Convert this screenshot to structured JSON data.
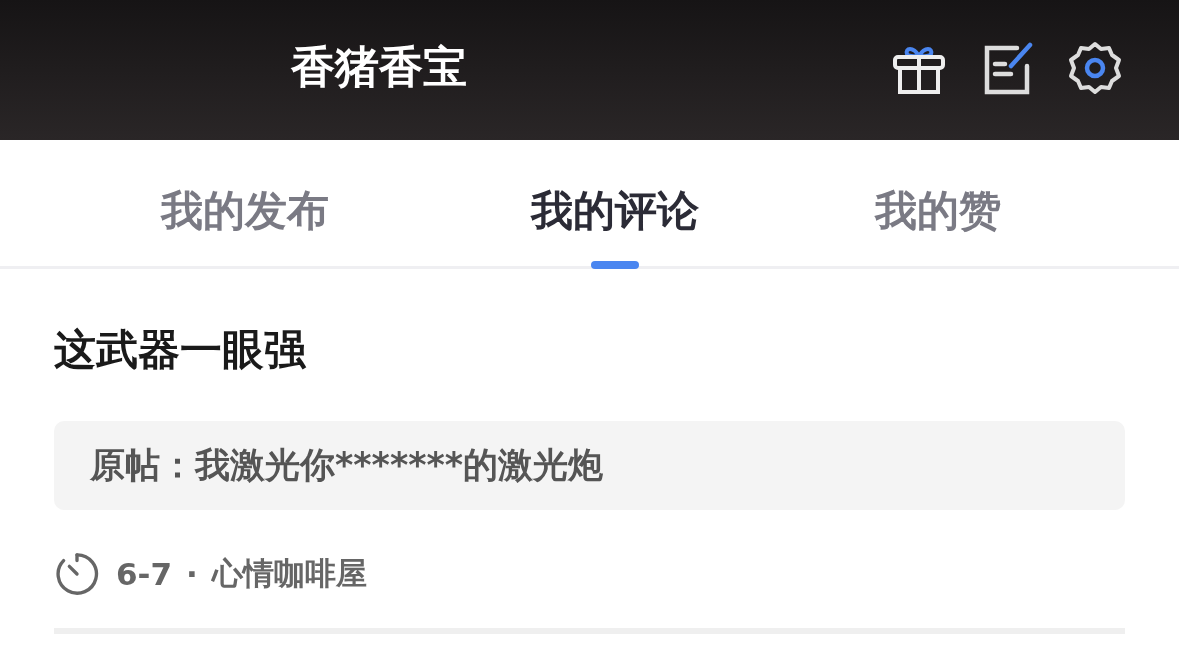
{
  "header": {
    "title": "香猪香宝"
  },
  "tabs": [
    {
      "label": "我的发布",
      "selected": false
    },
    {
      "label": "我的评论",
      "selected": true
    },
    {
      "label": "我的赞",
      "selected": false
    }
  ],
  "comments": [
    {
      "text": "这武器一眼强",
      "quote_label": "原帖：",
      "quote": "我激光你*******的激光炮",
      "date": "6-7",
      "separator": "·",
      "board": "心情咖啡屋"
    }
  ]
}
